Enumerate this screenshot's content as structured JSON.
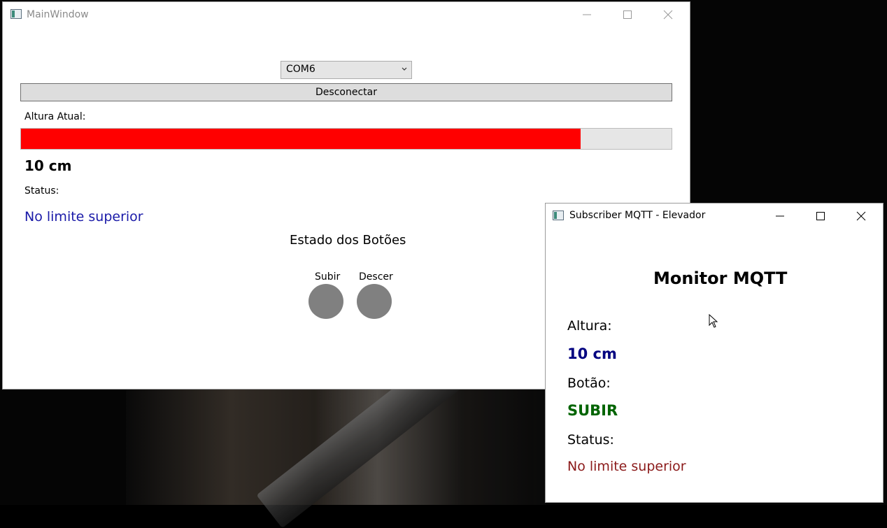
{
  "main_window": {
    "title": "MainWindow",
    "port_select": {
      "selected": "COM6"
    },
    "disconnect_label": "Desconectar",
    "height_label": "Altura Atual:",
    "height_progress": 0.86,
    "height_value": "10 cm",
    "status_label": "Status:",
    "status_value": "No limite superior",
    "buttons_title": "Estado dos Botões",
    "up_label": "Subir",
    "down_label": "Descer"
  },
  "mqtt_window": {
    "title": "Subscriber MQTT - Elevador",
    "heading": "Monitor MQTT",
    "height_label": "Altura:",
    "height_value": "10 cm",
    "button_label": "Botão:",
    "button_value": "SUBIR",
    "status_label": "Status:",
    "status_value": "No limite superior"
  },
  "colors": {
    "progress_fill": "#ff0000",
    "status_blue": "#1a1aa8",
    "mqtt_height": "#000080",
    "mqtt_button": "#006400",
    "mqtt_status": "#8b1a1a"
  }
}
